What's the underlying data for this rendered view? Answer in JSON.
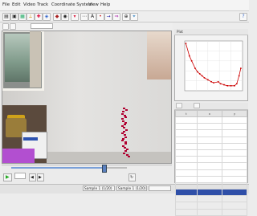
{
  "menu": [
    "File",
    "Edit",
    "Video",
    "Track",
    "Coordinate System",
    "View",
    "Help"
  ],
  "toolbar": {
    "frame_value": "",
    "count_label": "",
    "right_label": ""
  },
  "plot": {
    "tab_label": "Plot",
    "title": "",
    "series_color": "#cc0000",
    "points_norm": [
      [
        0.02,
        0.05
      ],
      [
        0.08,
        0.3
      ],
      [
        0.12,
        0.4
      ],
      [
        0.18,
        0.55
      ],
      [
        0.22,
        0.62
      ],
      [
        0.26,
        0.66
      ],
      [
        0.3,
        0.7
      ],
      [
        0.34,
        0.74
      ],
      [
        0.4,
        0.78
      ],
      [
        0.46,
        0.82
      ],
      [
        0.5,
        0.84
      ],
      [
        0.58,
        0.82
      ],
      [
        0.62,
        0.86
      ],
      [
        0.68,
        0.88
      ],
      [
        0.74,
        0.9
      ],
      [
        0.8,
        0.9
      ],
      [
        0.86,
        0.9
      ],
      [
        0.9,
        0.86
      ],
      [
        0.94,
        0.7
      ],
      [
        0.97,
        0.55
      ]
    ]
  },
  "table": {
    "headers": [
      "t",
      "x",
      "y"
    ],
    "rows": [
      [
        "",
        "",
        ""
      ],
      [
        "",
        "",
        ""
      ],
      [
        "",
        "",
        ""
      ],
      [
        "",
        "",
        ""
      ],
      [
        "",
        "",
        ""
      ],
      [
        "",
        "",
        ""
      ],
      [
        "",
        "",
        ""
      ],
      [
        "",
        "",
        ""
      ],
      [
        "",
        "",
        ""
      ],
      [
        "",
        "",
        ""
      ],
      [
        "",
        "",
        ""
      ],
      [
        "",
        "",
        ""
      ],
      [
        "",
        "",
        ""
      ],
      [
        "",
        "",
        ""
      ],
      [
        "",
        "",
        ""
      ]
    ],
    "highlighted_row": 11
  },
  "player": {
    "frame_counter": "",
    "progress": 0.8
  },
  "status": {
    "left": "Sample 1 (1/20)",
    "mid": "Sample 1 (1/20)",
    "right": ""
  },
  "colors": {
    "track": "#ff2a5a",
    "selection": "#2f4fa8"
  }
}
